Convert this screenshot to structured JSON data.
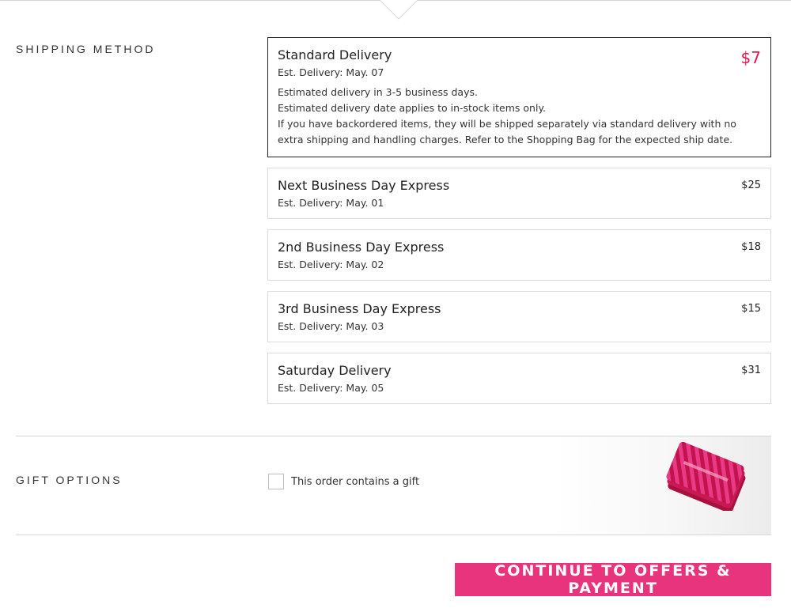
{
  "shipping": {
    "section_label": "SHIPPING METHOD",
    "options": [
      {
        "name": "Standard Delivery",
        "price": "$7",
        "est": "Est. Delivery: May. 07",
        "details": [
          "Estimated delivery in 3-5 business days.",
          "Estimated delivery date applies to in-stock items only.",
          "If you have backordered items, they will be shipped separately via standard delivery with no",
          "extra shipping and handling charges. Refer to the Shopping Bag for the expected ship date."
        ]
      },
      {
        "name": "Next Business Day Express",
        "price": "$25",
        "est": "Est. Delivery: May. 01"
      },
      {
        "name": "2nd Business Day Express",
        "price": "$18",
        "est": "Est. Delivery: May. 02"
      },
      {
        "name": "3rd Business Day Express",
        "price": "$15",
        "est": "Est. Delivery: May. 03"
      },
      {
        "name": "Saturday Delivery",
        "price": "$31",
        "est": "Est. Delivery: May. 05"
      }
    ],
    "selected_index": 0
  },
  "gift": {
    "section_label": "GIFT OPTIONS",
    "checkbox_label": "This order contains a gift",
    "checked": false,
    "image_icon": "gift-card-stack-icon"
  },
  "cta": {
    "label": "CONTINUE TO OFFERS & PAYMENT"
  },
  "colors": {
    "accent_pink": "#e8337d",
    "price_red": "#e0164f",
    "border": "#dcdcdc"
  }
}
